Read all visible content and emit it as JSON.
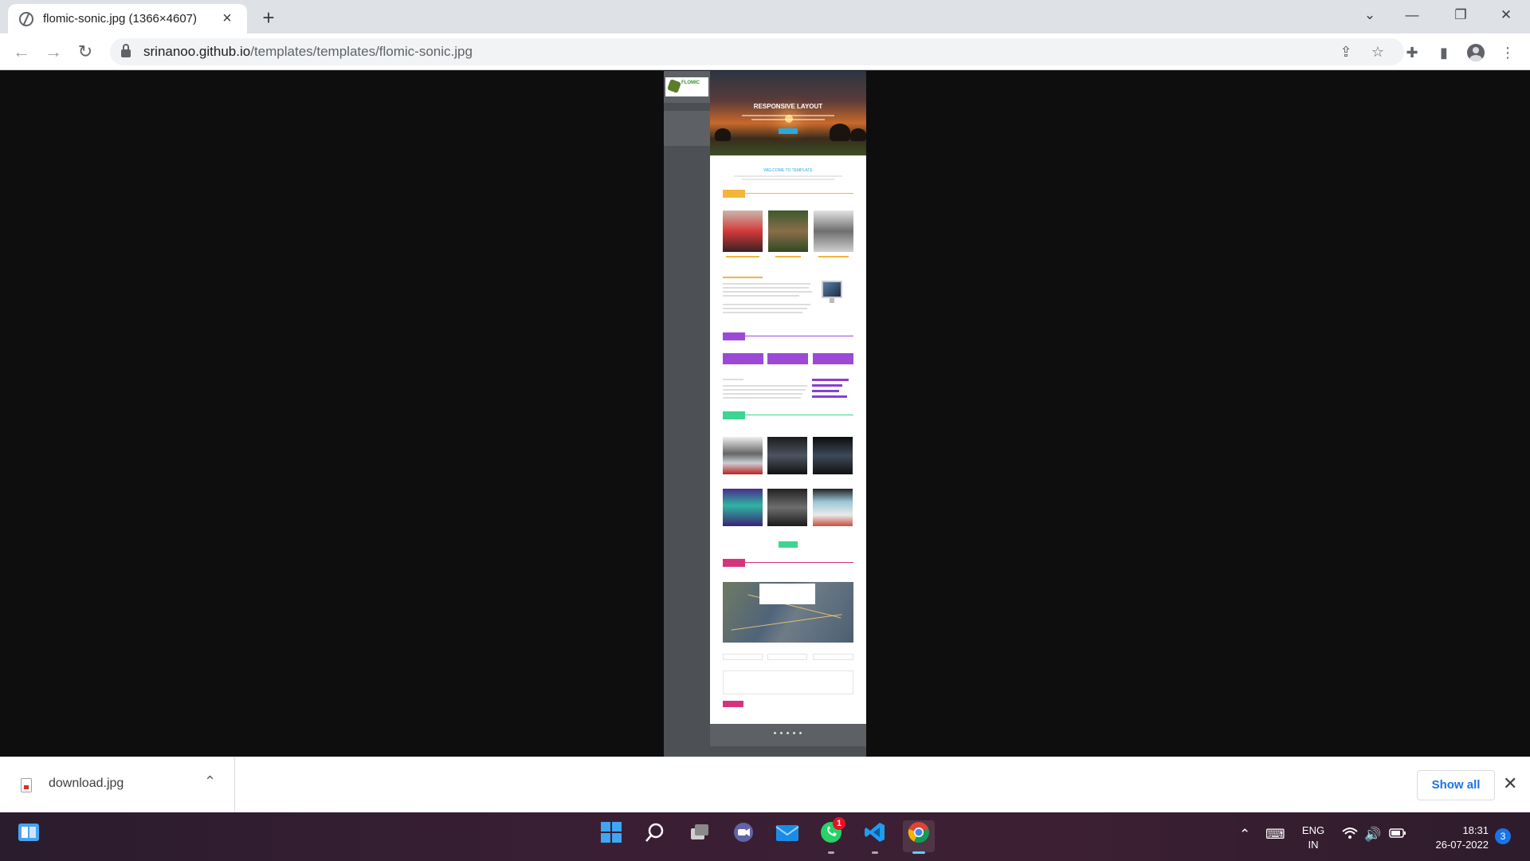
{
  "browser": {
    "tab_title": "flomic-sonic.jpg (1366×4607)",
    "new_tab_icon": "plus-icon",
    "url_host": "srinanoo.github.io",
    "url_path": "/templates/templates/flomic-sonic.jpg",
    "window_controls": [
      "chevron-down-icon",
      "minimize-icon",
      "restore-icon",
      "close-icon"
    ]
  },
  "screenshot_page": {
    "logo_text": "FLOMIC",
    "hero_title": "RESPONSIVE LAYOUT",
    "welcome": "WELCOME TO TEMPLATE",
    "section_colors": {
      "team": "#f2b53a",
      "services": "#9c4ad6",
      "portfolio": "#3cd68f",
      "contact": "#d6337e",
      "accent": "#29a9e0"
    }
  },
  "download_bar": {
    "file_name": "download.jpg",
    "show_all": "Show all"
  },
  "taskbar": {
    "apps": [
      "windows-start-icon",
      "search-icon",
      "task-view-icon",
      "chat-icon",
      "mail-icon",
      "whatsapp-icon",
      "vscode-icon",
      "chrome-icon"
    ],
    "whatsapp_badge": "1",
    "lang_line1": "ENG",
    "lang_line2": "IN",
    "time": "18:31",
    "date": "26-07-2022",
    "notification_count": "3"
  }
}
